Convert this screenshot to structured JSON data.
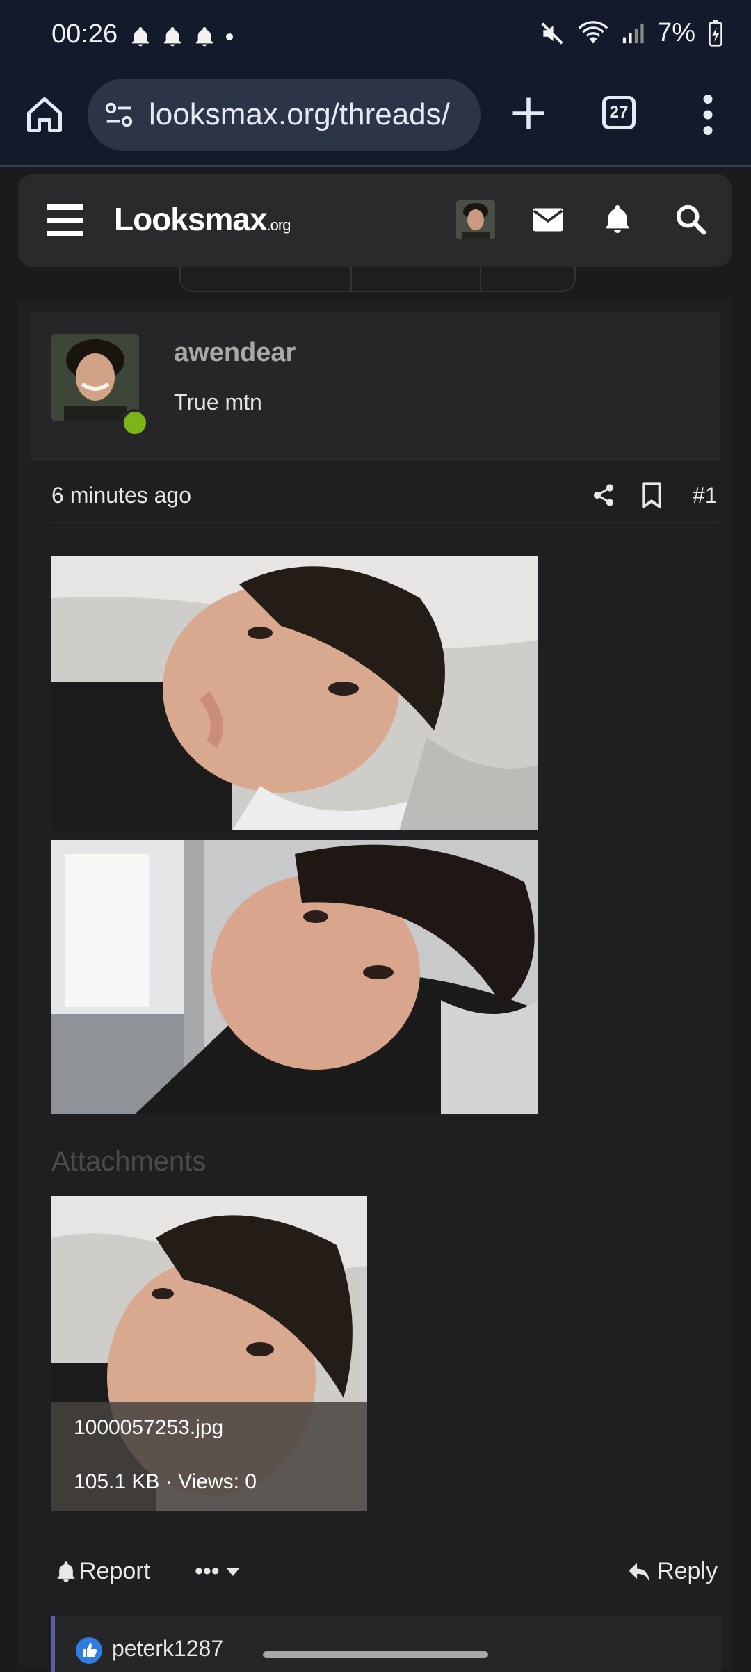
{
  "status_bar": {
    "time": "00:26",
    "battery": "7%",
    "icons": [
      "bell-icon",
      "bell-icon",
      "bell-icon",
      "dot-icon",
      "mute-icon",
      "wifi-icon",
      "signal-icon",
      "battery-charging-icon"
    ]
  },
  "browser": {
    "url": "looksmax.org/threads/",
    "tab_count": "27"
  },
  "site": {
    "logo_main": "Looksmax",
    "logo_suffix": ".org"
  },
  "post": {
    "username": "awendear",
    "user_title": "True mtn",
    "time": "6 minutes ago",
    "post_number": "#1",
    "attachments_heading": "Attachments",
    "attachment": {
      "filename": "1000057253.jpg",
      "meta": "105.1 KB · Views: 0"
    },
    "actions": {
      "report": "Report",
      "more": "•••",
      "reply": "Reply"
    },
    "reaction_user": "peterk1287"
  },
  "colors": {
    "status_bg": "#131a2b",
    "page_bg": "#1b1b1d",
    "online": "#7cb518",
    "like": "#2f7de1"
  }
}
